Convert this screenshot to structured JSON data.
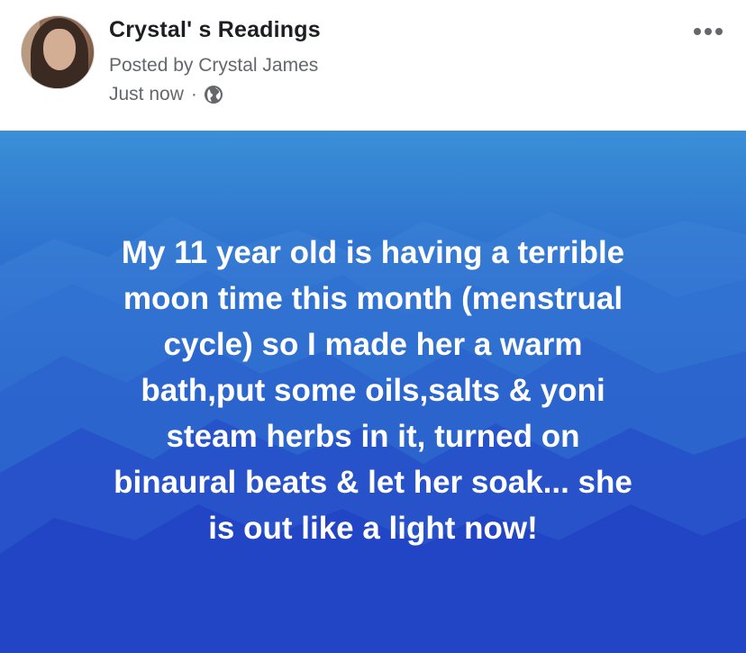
{
  "post": {
    "page_name": "Crystal' s Readings",
    "posted_by": "Posted by Crystal James",
    "timestamp": "Just now",
    "separator": "·",
    "privacy_icon": "globe-icon",
    "more_icon": "more-options-icon",
    "text": "My 11 year old is having a terrible\nmoon time this month (menstrual\ncycle) so I made her a warm\nbath,put some oils,salts & yoni\nsteam herbs in it, turned on\nbinaural beats & let her soak... she\nis out like a light now!"
  },
  "colors": {
    "background_top": "#3a8fd6",
    "background_bottom": "#1c33bd",
    "text": "#ffffff",
    "name": "#1c1e21",
    "meta": "#65676b"
  }
}
